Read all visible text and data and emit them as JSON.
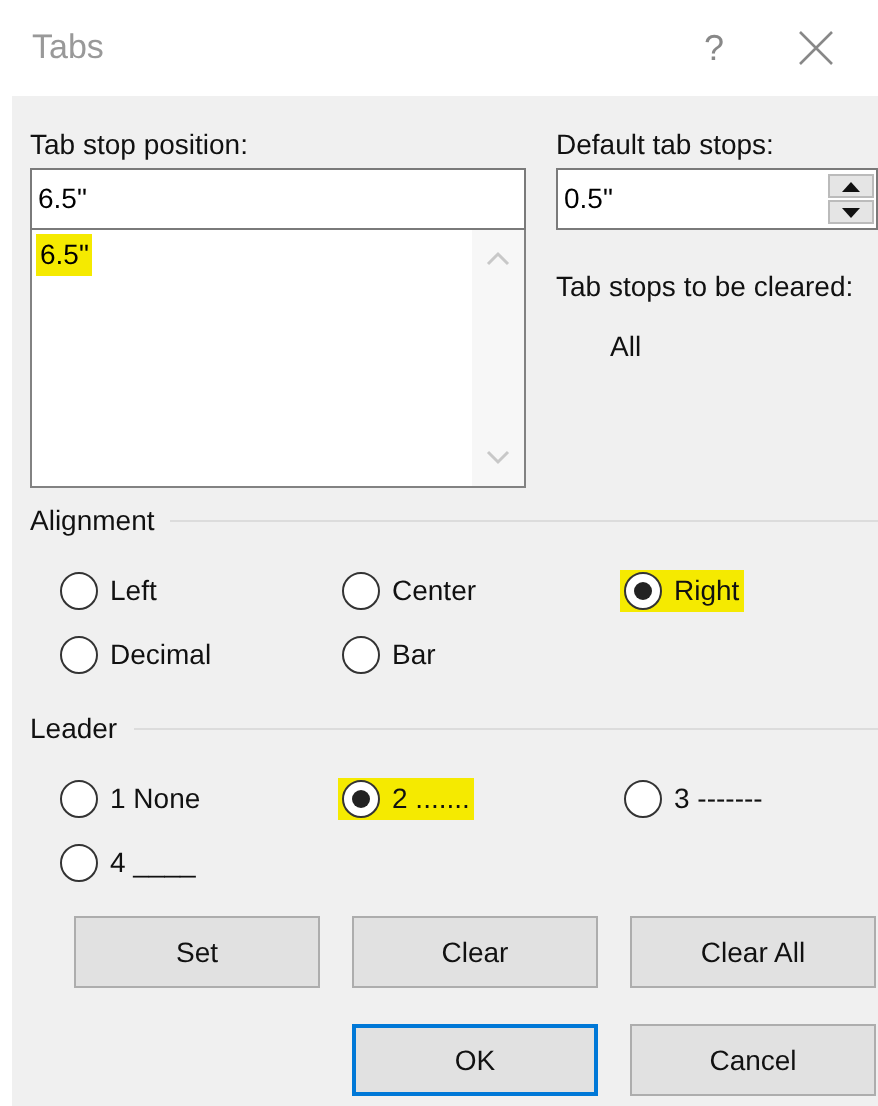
{
  "window": {
    "title": "Tabs",
    "help": "?"
  },
  "tab_stop_position": {
    "label": "Tab stop position:",
    "value": "6.5\"",
    "list": [
      {
        "text": "6.5\"",
        "highlighted": true
      }
    ]
  },
  "default_tab_stops": {
    "label": "Default tab stops:",
    "value": "0.5\""
  },
  "tab_stops_to_be_cleared": {
    "label": "Tab stops to be cleared:",
    "value": "All"
  },
  "alignment": {
    "heading": "Alignment",
    "options": [
      {
        "label": "Left",
        "selected": false,
        "highlighted": false
      },
      {
        "label": "Center",
        "selected": false,
        "highlighted": false
      },
      {
        "label": "Right",
        "selected": true,
        "highlighted": true
      },
      {
        "label": "Decimal",
        "selected": false,
        "highlighted": false
      },
      {
        "label": "Bar",
        "selected": false,
        "highlighted": false
      }
    ]
  },
  "leader": {
    "heading": "Leader",
    "options": [
      {
        "label": "1 None",
        "selected": false,
        "highlighted": false
      },
      {
        "label": "2 .......",
        "selected": true,
        "highlighted": true
      },
      {
        "label": "3 -------",
        "selected": false,
        "highlighted": false
      },
      {
        "label": "4 ____",
        "selected": false,
        "highlighted": false
      }
    ]
  },
  "buttons": [
    {
      "label": "Set",
      "default": false
    },
    {
      "label": "Clear",
      "default": false
    },
    {
      "label": "Clear All",
      "default": false
    }
  ],
  "footer_buttons": [
    {
      "label": "OK",
      "default": true
    },
    {
      "label": "Cancel",
      "default": false
    }
  ]
}
